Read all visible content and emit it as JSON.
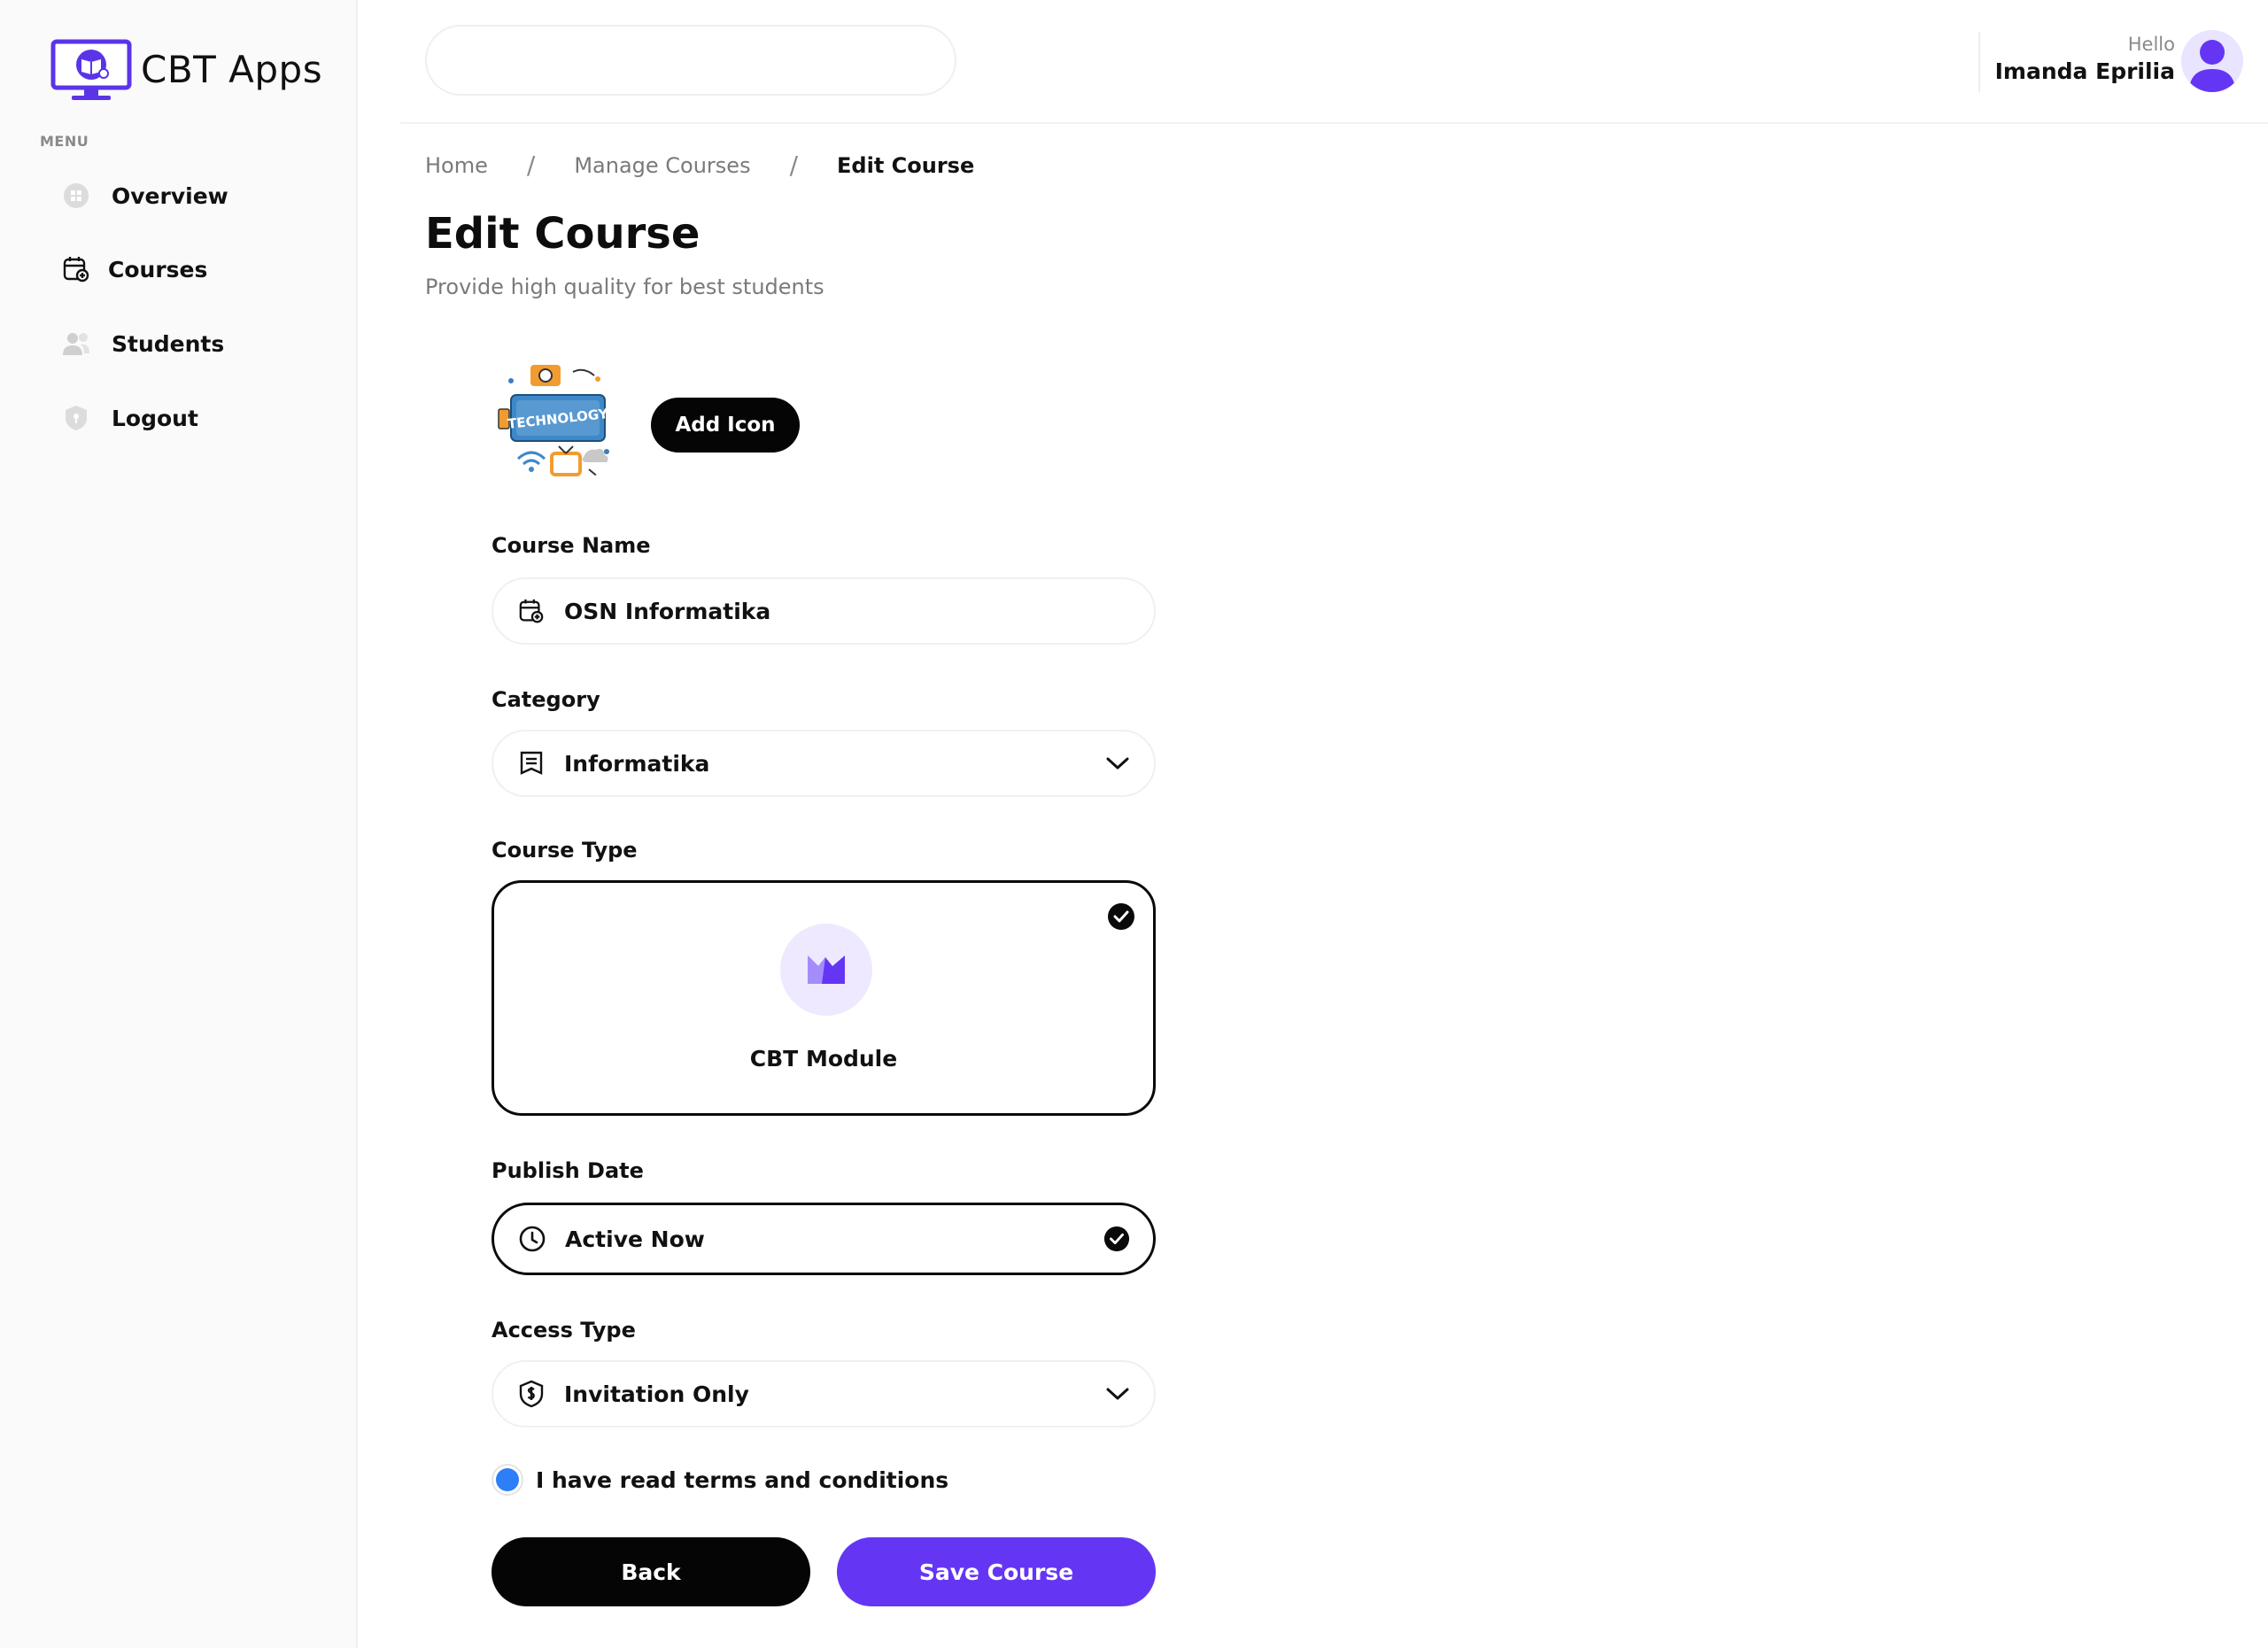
{
  "app": {
    "name": "CBT Apps"
  },
  "sidebar": {
    "menu_label": "MENU",
    "items": [
      {
        "label": "Overview",
        "icon": "overview-icon"
      },
      {
        "label": "Courses",
        "icon": "courses-icon"
      },
      {
        "label": "Students",
        "icon": "students-icon"
      },
      {
        "label": "Logout",
        "icon": "logout-icon"
      }
    ]
  },
  "header": {
    "search": {
      "placeholder": "",
      "value": ""
    },
    "greeting": "Hello",
    "user_name": "Imanda Eprilia"
  },
  "breadcrumb": [
    "Home",
    "Manage Courses",
    "Edit Course"
  ],
  "page": {
    "title": "Edit Course",
    "subtitle": "Provide high quality for best students"
  },
  "form": {
    "icon_image_text": "TECHNOLOGY",
    "add_icon_label": "Add Icon",
    "course_name": {
      "label": "Course Name",
      "value": "OSN Informatika"
    },
    "category": {
      "label": "Category",
      "value": "Informatika"
    },
    "course_type": {
      "label": "Course Type",
      "option": "CBT Module",
      "selected": true
    },
    "publish_date": {
      "label": "Publish Date",
      "value": "Active Now",
      "selected": true
    },
    "access_type": {
      "label": "Access Type",
      "value": "Invitation Only"
    },
    "terms": {
      "label": "I have read terms and conditions",
      "checked": true
    },
    "back_label": "Back",
    "save_label": "Save Course"
  },
  "colors": {
    "primary": "#6436f4",
    "dark": "#050505",
    "radio_blue": "#2d7ef7",
    "sidebar_bg": "#fafafa"
  }
}
